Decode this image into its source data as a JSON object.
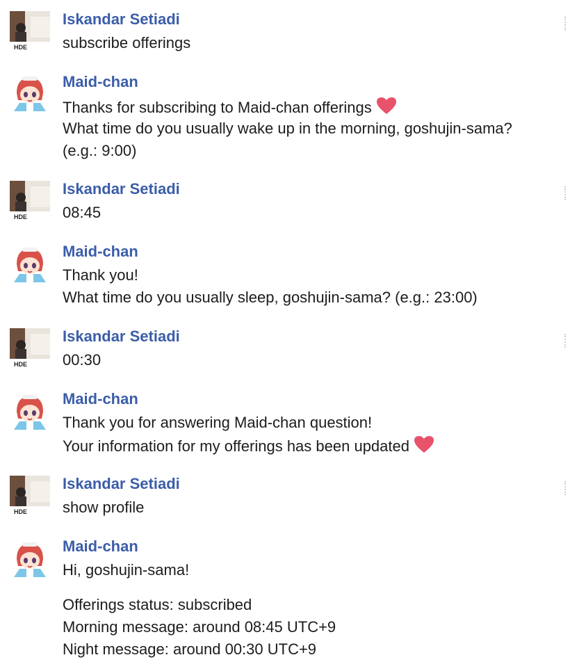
{
  "messages": [
    {
      "author": "Iskandar Setiadi",
      "avatar": "photo-avatar",
      "lines": [
        "subscribe offerings"
      ]
    },
    {
      "author": "Maid-chan",
      "avatar": "anime-maid-avatar",
      "lines": [
        "Thanks for subscribing to Maid-chan offerings",
        "What time do you usually wake up in the morning, goshujin-sama?",
        "(e.g.: 9:00)"
      ]
    },
    {
      "author": "Iskandar Setiadi",
      "avatar": "photo-avatar",
      "lines": [
        "08:45"
      ]
    },
    {
      "author": "Maid-chan",
      "avatar": "anime-maid-avatar",
      "lines": [
        "Thank you!",
        "What time do you usually sleep, goshujin-sama? (e.g.: 23:00)"
      ]
    },
    {
      "author": "Iskandar Setiadi",
      "avatar": "photo-avatar",
      "lines": [
        "00:30"
      ]
    },
    {
      "author": "Maid-chan",
      "avatar": "anime-maid-avatar",
      "lines": [
        "Thank you for answering Maid-chan question!",
        "Your information for my offerings has been updated"
      ]
    },
    {
      "author": "Iskandar Setiadi",
      "avatar": "photo-avatar",
      "lines": [
        "show profile"
      ]
    },
    {
      "author": "Maid-chan",
      "avatar": "anime-maid-avatar",
      "lines": [
        "Hi, goshujin-sama!",
        "Offerings status: subscribed",
        "Morning message: around 08:45 UTC+9",
        "Night message: around 00:30 UTC+9"
      ]
    }
  ],
  "colors": {
    "author": "#3b5da8",
    "text": "#1d1c1d",
    "heart": "#e8536b"
  },
  "icons": {
    "heart": "heart-emoji-icon",
    "avatar_badge": "HDE"
  }
}
